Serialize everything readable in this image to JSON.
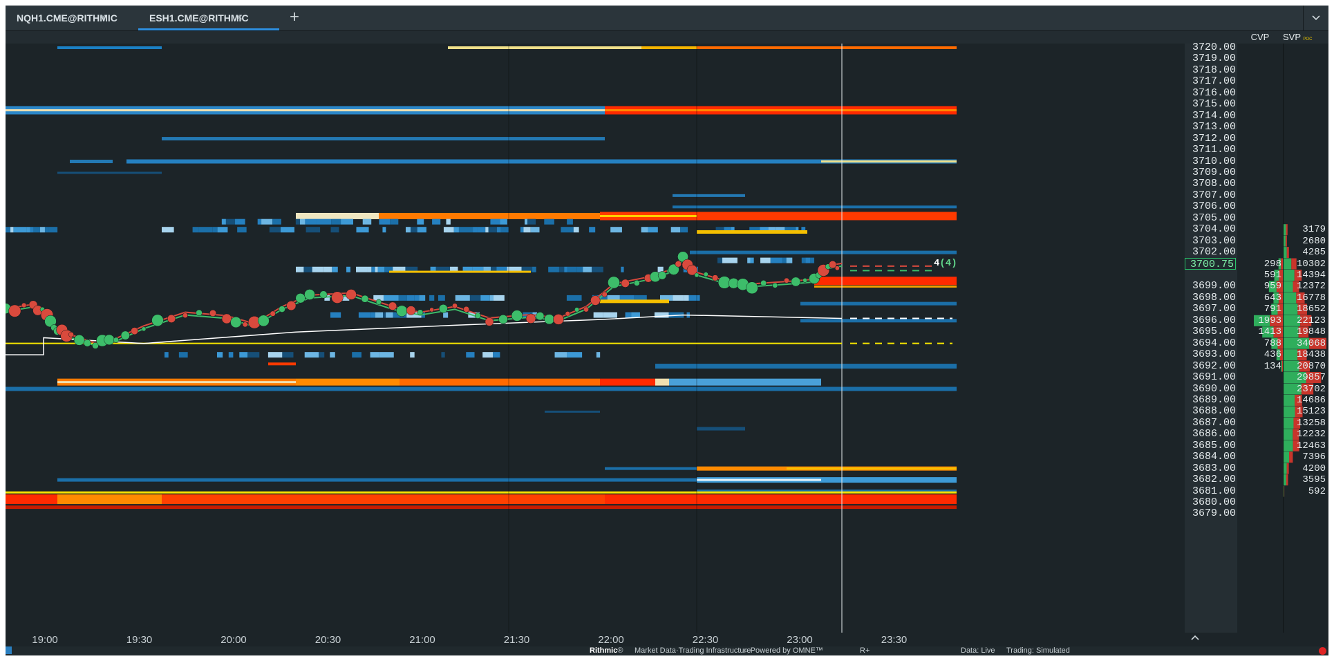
{
  "tabs": [
    {
      "label": "NQH1.CME@RITHMIC",
      "close": "×",
      "active": false
    },
    {
      "label": "ESH1.CME@RITHMIC",
      "close": "×",
      "active": true
    }
  ],
  "tabbar": {
    "add_icon": "plus-icon",
    "add_glyph": "+",
    "menu_icon": "chevron-down-icon",
    "menu_glyph": "⌵"
  },
  "columns": {
    "cvp": "CVP",
    "svp": "SVP",
    "poc": "POC"
  },
  "price_ticks": [
    "3720.00",
    "3719.00",
    "3718.00",
    "3717.00",
    "3716.00",
    "3715.00",
    "3714.00",
    "3713.00",
    "3712.00",
    "3711.00",
    "3710.00",
    "3709.00",
    "3708.00",
    "3707.00",
    "3706.00",
    "3705.00",
    "3704.00",
    "3703.00",
    "3702.00",
    "3700.75",
    "3699.00",
    "3698.00",
    "3697.00",
    "3696.00",
    "3695.00",
    "3694.00",
    "3693.00",
    "3692.00",
    "3691.00",
    "3690.00",
    "3689.00",
    "3688.00",
    "3687.00",
    "3686.00",
    "3685.00",
    "3684.00",
    "3683.00",
    "3682.00",
    "3681.00",
    "3680.00",
    "3679.00"
  ],
  "current_price": "3700.75",
  "last_trade_label": "4",
  "last_trade_paren": "(4)",
  "cvp_values": [
    {
      "price": "3700.75",
      "value": "298"
    },
    {
      "price": "3700.00",
      "value": "591"
    },
    {
      "price": "3699.00",
      "value": "959"
    },
    {
      "price": "3698.00",
      "value": "643"
    },
    {
      "price": "3697.00",
      "value": "791"
    },
    {
      "price": "3696.00",
      "value": "1993"
    },
    {
      "price": "3695.00",
      "value": "1413"
    },
    {
      "price": "3694.00",
      "value": "788"
    },
    {
      "price": "3693.00",
      "value": "436"
    },
    {
      "price": "3692.00",
      "value": "134"
    }
  ],
  "svp_values": [
    {
      "price": "3704.00",
      "value": "3179"
    },
    {
      "price": "3703.00",
      "value": "2680"
    },
    {
      "price": "3702.00",
      "value": "4285"
    },
    {
      "price": "3700.75",
      "value": "10302"
    },
    {
      "price": "3700.00",
      "value": "14394"
    },
    {
      "price": "3699.00",
      "value": "12372"
    },
    {
      "price": "3698.00",
      "value": "16778"
    },
    {
      "price": "3697.00",
      "value": "18652"
    },
    {
      "price": "3696.00",
      "value": "22123"
    },
    {
      "price": "3695.00",
      "value": "19848"
    },
    {
      "price": "3694.00",
      "value": "34068"
    },
    {
      "price": "3693.00",
      "value": "18438"
    },
    {
      "price": "3692.00",
      "value": "20870"
    },
    {
      "price": "3691.00",
      "value": "29857"
    },
    {
      "price": "3690.00",
      "value": "23702"
    },
    {
      "price": "3689.00",
      "value": "14686"
    },
    {
      "price": "3688.00",
      "value": "15123"
    },
    {
      "price": "3687.00",
      "value": "13258"
    },
    {
      "price": "3686.00",
      "value": "12232"
    },
    {
      "price": "3685.00",
      "value": "12463"
    },
    {
      "price": "3684.00",
      "value": "7396"
    },
    {
      "price": "3683.00",
      "value": "4200"
    },
    {
      "price": "3682.00",
      "value": "3595"
    },
    {
      "price": "3681.00",
      "value": "592"
    }
  ],
  "time_labels": [
    "19:00",
    "19:30",
    "20:00",
    "20:30",
    "21:00",
    "21:30",
    "22:00",
    "22:30",
    "23:00",
    "23:30"
  ],
  "footer": {
    "brand": "Rithmic",
    "brand_tm": "®",
    "tagline": "Market Data·Trading Infrastructure",
    "powered": "Powered by OMNE™",
    "r_plus": "R+",
    "data_status": "Data: Live",
    "trading_status": "Trading: Simulated"
  },
  "colors": {
    "bid_ask_heat_low": "#1b6fa8",
    "heat_mid": "#f7c600",
    "heat_high": "#ff2a00",
    "buy_bubble": "#3dbd6a",
    "sell_bubble": "#d94a3d",
    "vwap": "#ffffff",
    "poc_line": "#f0e000"
  },
  "icons": {
    "scroll_up": "chevron-up-icon",
    "scroll_glyph": "︿",
    "status_dot": "record-dot-icon"
  }
}
